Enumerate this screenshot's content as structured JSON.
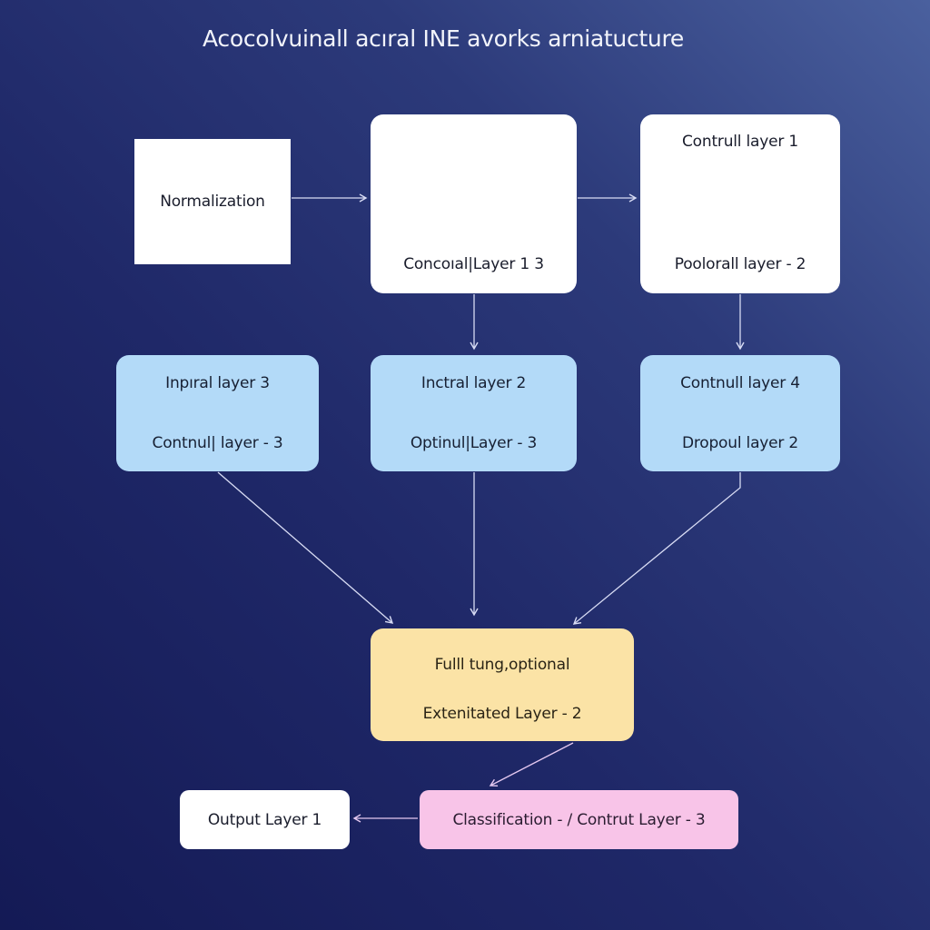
{
  "title": "Acocolvuinall acıral INE avorks arniatucture",
  "colors": {
    "background_top_right": "#4a609e",
    "background_bottom_left": "#141a55",
    "box_white": "#ffffff",
    "box_blue": "#b3daf8",
    "box_yellow": "#fbe3a6",
    "box_pink": "#f8c4e8",
    "connector": "#d8dcf4",
    "connector_pink": "#e4c8f0"
  },
  "nodes": {
    "normalization": {
      "lines": [
        "Normalization"
      ]
    },
    "conv": {
      "lines": [
        "Concoıal|Layer 1 3"
      ]
    },
    "control1": {
      "lines": [
        "Contrull layer 1",
        "Poolorall layer - 2"
      ]
    },
    "inpiral": {
      "lines": [
        "Inpıral layer 3",
        "Contnul| layer - 3"
      ]
    },
    "inctral": {
      "lines": [
        "Inctral layer 2",
        "Optinul|Layer - 3"
      ]
    },
    "contnull4": {
      "lines": [
        "Contnull layer 4",
        "Dropoul layer 2"
      ]
    },
    "full": {
      "lines": [
        "Fulll tung,optional",
        "Extenitated Layer - 2"
      ]
    },
    "output": {
      "lines": [
        "Output Layer 1"
      ]
    },
    "classification": {
      "lines": [
        "Classification - / Contrut Layer - 3"
      ]
    }
  },
  "edges": [
    {
      "from": "normalization",
      "to": "conv"
    },
    {
      "from": "conv",
      "to": "control1"
    },
    {
      "from": "conv",
      "to": "inctral"
    },
    {
      "from": "control1",
      "to": "contnull4"
    },
    {
      "from": "inpiral",
      "to": "full"
    },
    {
      "from": "inctral",
      "to": "full"
    },
    {
      "from": "contnull4",
      "to": "full"
    },
    {
      "from": "full",
      "to": "classification"
    },
    {
      "from": "classification",
      "to": "output"
    }
  ]
}
